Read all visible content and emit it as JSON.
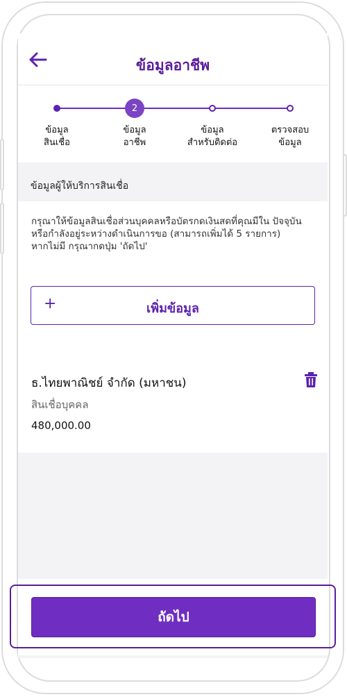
{
  "header": {
    "title": "ข้อมูลอาชีพ",
    "back_icon": "arrow-left-icon"
  },
  "stepper": {
    "active_step": "2",
    "steps": [
      {
        "label": "ข้อมูล\nสินเชื่อ",
        "state": "done"
      },
      {
        "label": "ข้อมูล\nอาชีพ",
        "state": "active"
      },
      {
        "label": "ข้อมูล\nสำหรับติดต่อ",
        "state": "todo"
      },
      {
        "label": "ตรวจสอบ\nข้อมูล",
        "state": "todo"
      }
    ]
  },
  "section": {
    "heading": "ข้อมูลผู้ให้บริการสินเชื่อ"
  },
  "info": {
    "text": "กรุณาให้ข้อมูลสินเชื่อส่วนบุคคลหรือบัตรกดเงินสดที่คุณมีใน ปัจจุบัน หรือกำลังอยู่ระหว่างดำเนินการขอ (สามารถเพิ่มได้ 5 รายการ)",
    "text2": "หากไม่มี กรุณากดปุ่ม 'ถัดไป'",
    "add_button": "เพิ่มข้อมูล",
    "add_icon": "+"
  },
  "loan_card": {
    "provider": "ธ.ไทยพาณิชย์ จำกัด (มหาชน)",
    "type": "สินเชื่อบุคคล",
    "amount": "480,000.00",
    "delete_icon": "trash-icon"
  },
  "footer": {
    "next_button": "ถัดไป"
  },
  "colors": {
    "primary": "#5c22b0",
    "button": "#6f2ec1",
    "background": "#f3f3f6"
  }
}
